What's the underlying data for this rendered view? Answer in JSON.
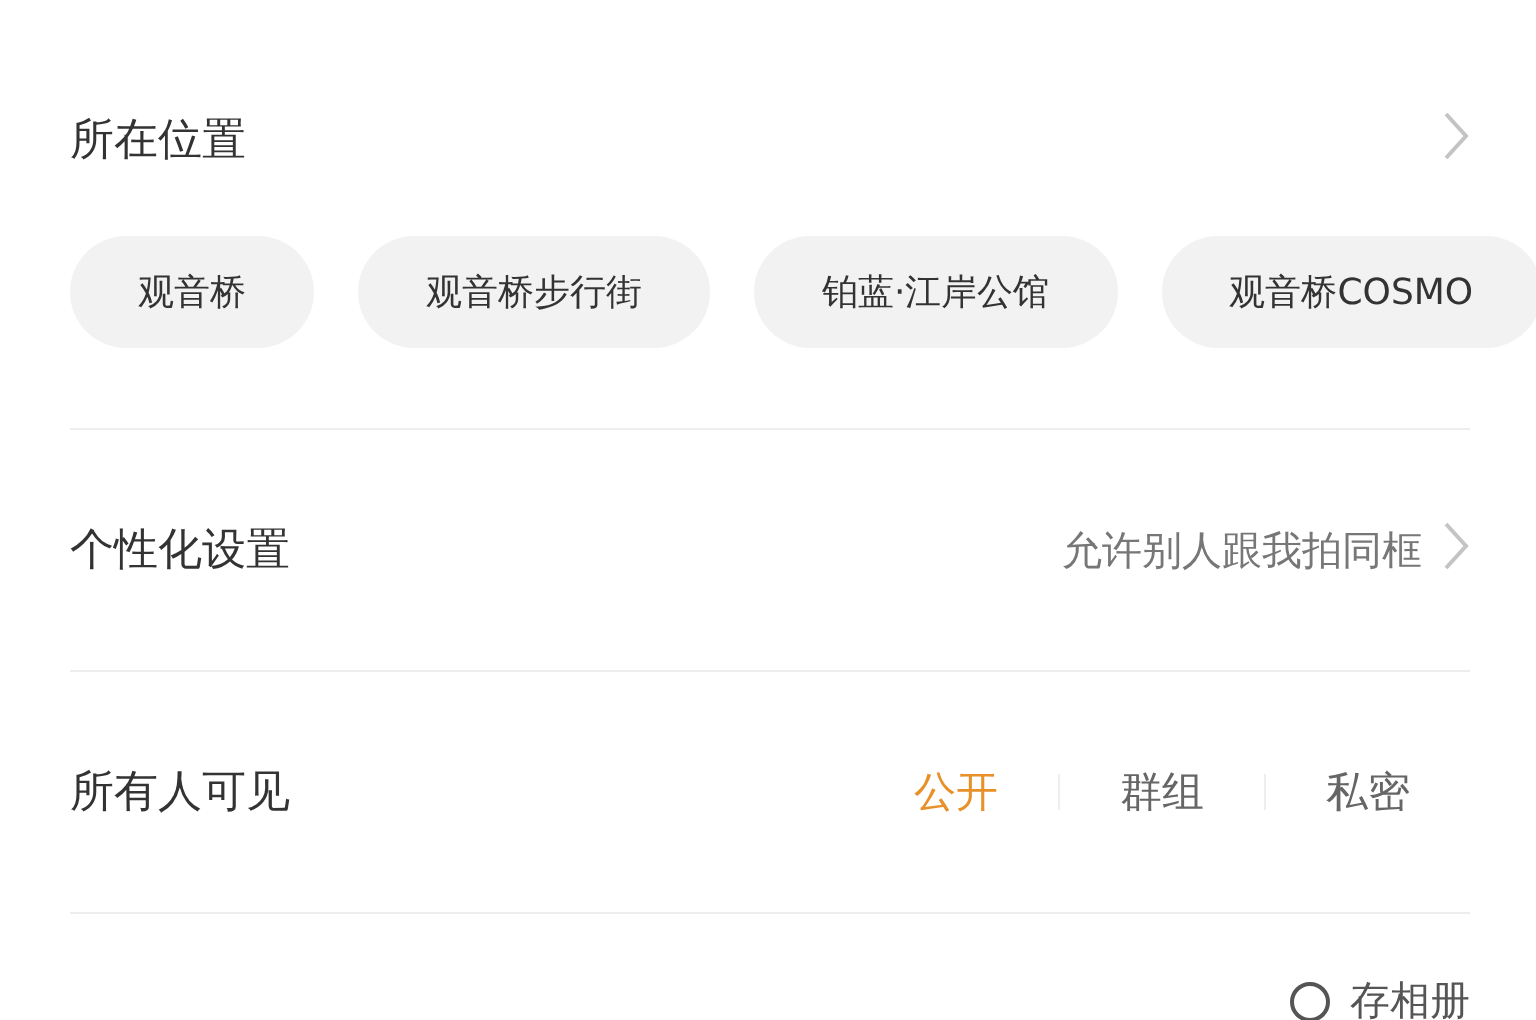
{
  "location": {
    "title": "所在位置",
    "chips": [
      "观音桥",
      "观音桥步行街",
      "铂蓝·江岸公馆",
      "观音桥COSMO"
    ]
  },
  "personalization": {
    "title": "个性化设置",
    "value": "允许别人跟我拍同框"
  },
  "visibility": {
    "title": "所有人可见",
    "options": [
      {
        "label": "公开",
        "selected": true
      },
      {
        "label": "群组",
        "selected": false
      },
      {
        "label": "私密",
        "selected": false
      }
    ]
  },
  "save_option": {
    "label": "存相册",
    "checked": false
  }
}
